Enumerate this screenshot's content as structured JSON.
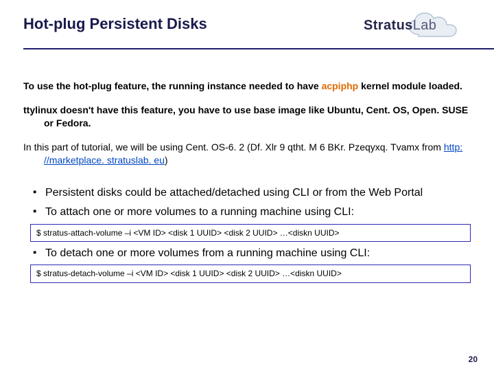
{
  "header": {
    "title": "Hot-plug Persistent Disks",
    "logo": {
      "brand_a": "Stratus",
      "brand_b": "Lab"
    }
  },
  "paras": {
    "p1_a": "To use the hot-plug feature, the running instance needed to have ",
    "p1_b": "acpiphp",
    "p1_c": " kernel module loaded.",
    "p2": " ttylinux doesn't have this feature, you have to use base image like Ubuntu, Cent. OS, Open. SUSE or Fedora.",
    "p3_a": "In this part of tutorial, we will be using Cent. OS-6. 2 (Df. Xlr 9 qtht. M 6 BKr. Pzeqyxq. Tvamx from ",
    "p3_link": "http: //marketplace. stratuslab. eu",
    "p3_b": ")"
  },
  "bullets": {
    "b1": "Persistent disks could be attached/detached using CLI or from the Web Portal",
    "b2": "To attach  one or more volumes to a running machine using CLI:",
    "b3": "To detach one or more volumes from a running machine using CLI:"
  },
  "code": {
    "attach": "$ stratus-attach-volume –i <VM ID> <disk 1 UUID> <disk 2 UUID> …<diskn UUID>",
    "detach": "$ stratus-detach-volume –i <VM ID> <disk 1 UUID> <disk 2 UUID> …<diskn UUID>"
  },
  "page_number": "20"
}
